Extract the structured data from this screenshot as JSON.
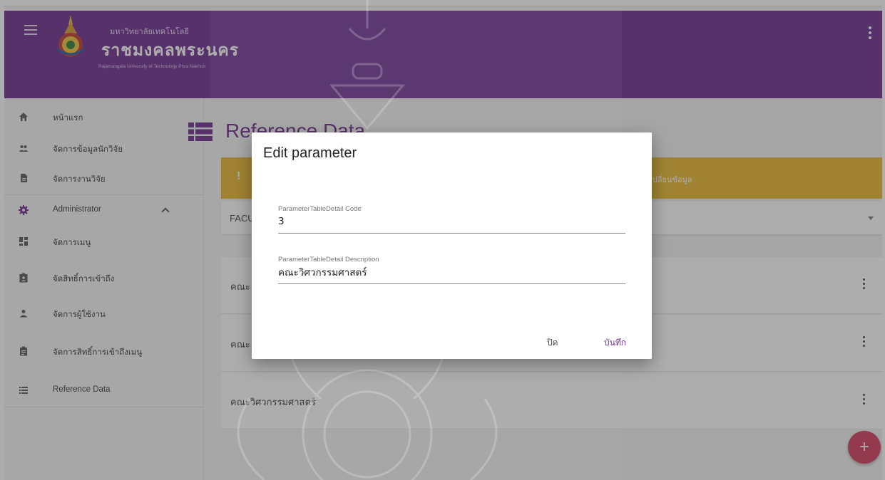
{
  "header": {
    "university_th_small": "มหาวิทยาลัยเทคโนโลยี",
    "university_th_main": "ราชมงคลพระนคร",
    "university_en": "Rajamangala University of Technology Phra Nakhon"
  },
  "sidebar": {
    "items": [
      {
        "label": "หน้าแรก",
        "icon": "home-icon"
      },
      {
        "label": "จัดการข้อมูลนักวิจัย",
        "icon": "people-icon"
      },
      {
        "label": "จัดการงานวิจัย",
        "icon": "document-icon"
      },
      {
        "label": "Administrator",
        "icon": "gear-icon"
      },
      {
        "label": "จัดการเมนู",
        "icon": "dashboard-icon"
      },
      {
        "label": "จัดสิทธิ์การเข้าถึง",
        "icon": "badge-icon"
      },
      {
        "label": "จัดการผู้ใช้งาน",
        "icon": "person-icon"
      },
      {
        "label": "จัดการสิทธิ์การเข้าถึงเมนู",
        "icon": "assignment-icon"
      },
      {
        "label": "Reference Data",
        "icon": "list-icon"
      }
    ]
  },
  "main": {
    "title": "Reference Data",
    "warning_icon": "!",
    "warning_text": "เปลี่ยนข้อมูล",
    "select_value": "FACU",
    "rows": [
      {
        "text": "คณะ"
      },
      {
        "text": "คณะ"
      },
      {
        "text": "คณะวิศวกรรมศาสตร์"
      }
    ],
    "fab_label": "+"
  },
  "dialog": {
    "title": "Edit parameter",
    "code_label": "ParameterTableDetail Code",
    "code_value": "3",
    "desc_label": "ParameterTableDetail Description",
    "desc_value": "คณะวิศวกรรมศาสตร์",
    "close_label": "ปิด",
    "save_label": "บันทึก"
  },
  "colors": {
    "primary": "#6a2a8c",
    "warning": "#e8b72c",
    "fab": "#d33a5c",
    "save_text": "#7b2da0"
  }
}
